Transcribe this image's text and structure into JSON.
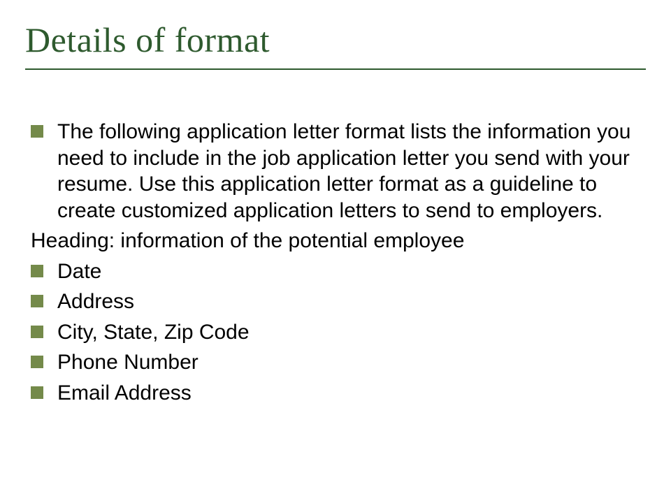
{
  "slide": {
    "title": "Details of format",
    "intro": "The following application letter format lists the information you need to include in the job application letter you send with your resume. Use this application letter format as a guideline to create customized application letters to send to employers.",
    "heading_line": "Heading: information of the potential employee",
    "items": {
      "date": "Date",
      "address": "Address",
      "city_state_zip": "City, State, Zip Code",
      "phone": "Phone Number",
      "email": "Email Address"
    }
  }
}
